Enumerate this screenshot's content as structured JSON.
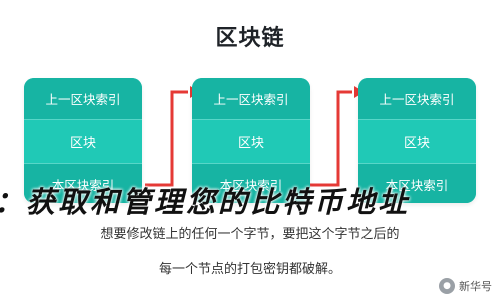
{
  "diagram": {
    "title": "区块链",
    "blocks": [
      {
        "prev_hash": "上一区块索引",
        "body": "区块",
        "own_hash": "本区块索引"
      },
      {
        "prev_hash": "上一区块索引",
        "body": "区块",
        "own_hash": "本区块索引"
      },
      {
        "prev_hash": "上一区块索引",
        "body": "区块",
        "own_hash": "本区块索引"
      }
    ],
    "caption_line1": "想要修改链上的任何一个字节，要把这个字节之后的",
    "caption_line2": "每一个节点的打包密钥都破解。"
  },
  "overlay_text": "：获取和管理您的比特币地址",
  "watermark": {
    "icon": "wechat-icon",
    "text": "新华号"
  },
  "colors": {
    "block": "#20c9b6",
    "block_dark": "#17b4a3",
    "arrow": "#e53935"
  }
}
